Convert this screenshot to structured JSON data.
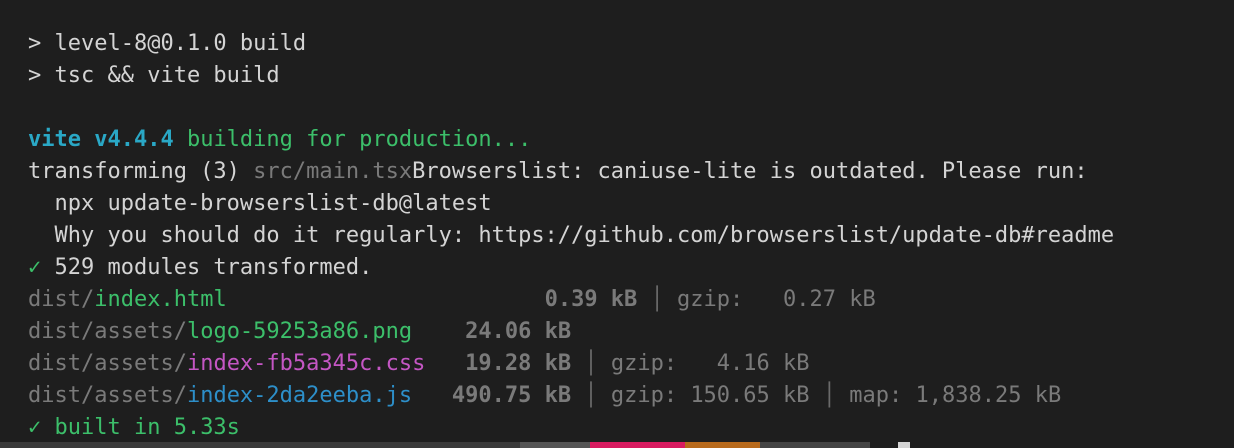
{
  "cmd": {
    "line1": "> level-8@0.1.0 build",
    "line2": "> tsc && vite build"
  },
  "vite": {
    "name": "vite v4.4.4",
    "msg": " building for production..."
  },
  "transform": {
    "prefix": "transforming (3) ",
    "file": "src/main.tsx",
    "warning": "Browserslist: caniuse-lite is outdated. Please run:",
    "cmd": "  npx update-browserslist-db@latest",
    "why": "  Why you should do it regularly: https://github.com/browserslist/update-db#readme"
  },
  "done": {
    "check": "✓",
    "text": " 529 modules transformed."
  },
  "files": [
    {
      "dir": "dist/",
      "name": "index.html",
      "size": "0.39 kB",
      "gzip": "gzip:   0.27 kB",
      "map": ""
    },
    {
      "dir": "dist/assets/",
      "name": "logo-59253a86.png",
      "size": "24.06 kB",
      "gzip": "",
      "map": ""
    },
    {
      "dir": "dist/assets/",
      "name": "index-fb5a345c.css",
      "size": "19.28 kB",
      "gzip": "gzip:   4.16 kB",
      "map": ""
    },
    {
      "dir": "dist/assets/",
      "name": "index-2da2eeba.js",
      "size": "490.75 kB",
      "gzip": "gzip: 150.65 kB",
      "map": "map: 1,838.25 kB"
    }
  ],
  "built": {
    "check": "✓",
    "text": " built in 5.33s"
  },
  "colors": {
    "background": "#1e1e1e",
    "text": "#d4d4d4",
    "muted": "#7a7a7a",
    "cyan": "#2aa8c6",
    "green": "#3cbf6a",
    "magenta": "#c456c4",
    "blue": "#2d8fc9"
  }
}
